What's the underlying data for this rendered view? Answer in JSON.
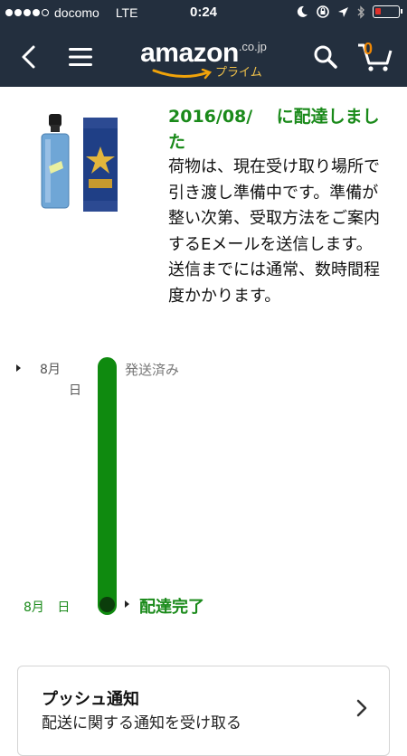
{
  "status_bar": {
    "carrier": "docomo",
    "network": "LTE",
    "time": "0:24",
    "signal_bars": 4,
    "battery_level": 0.15
  },
  "nav": {
    "logo_text": "amazon",
    "logo_tld": ".co.jp",
    "logo_prime": "プライム",
    "cart_count": "0"
  },
  "product": {
    "image_icon": "perfume-product-image"
  },
  "delivery": {
    "heading": "2016/08/    に配達しました",
    "message": "荷物は、現在受け取り場所で引き渡し準備中です。準備が整い次第、受取方法をご案内するEメールを送信します。送信までには通常、数時間程度かかります。"
  },
  "timeline": {
    "shipped_month": "8月",
    "shipped_day": "日",
    "shipped_label": "発送済み",
    "delivered_date": "8月 日",
    "delivered_label": "配達完了",
    "color": "#0f8a0f"
  },
  "push": {
    "title": "プッシュ通知",
    "subtitle": "配送に関する通知を受け取る"
  },
  "colors": {
    "nav_bg": "#232f3e",
    "accent_green": "#1a8a1a",
    "cart_orange": "#f08804"
  }
}
